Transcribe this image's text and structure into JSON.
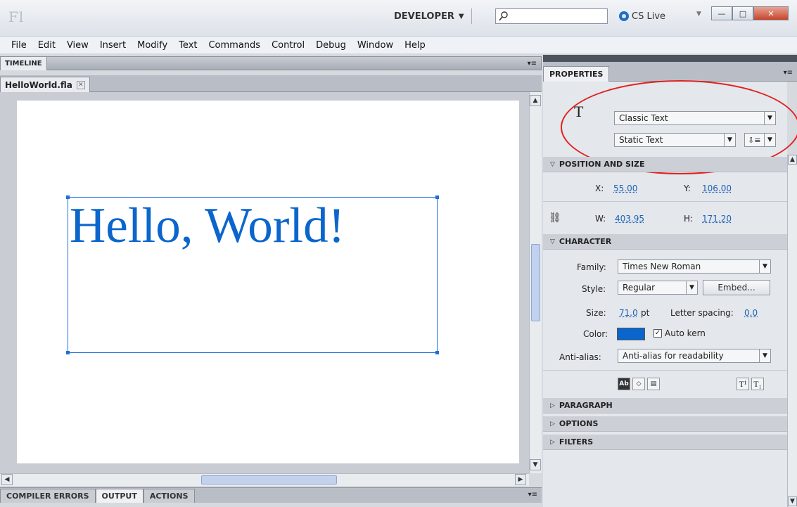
{
  "titlebar": {
    "logo": "Fl",
    "workspace": "DEVELOPER",
    "search_placeholder": "",
    "cslive": "CS Live",
    "minimize": "—",
    "maximize": "□",
    "close": "✕"
  },
  "menu": [
    "File",
    "Edit",
    "View",
    "Insert",
    "Modify",
    "Text",
    "Commands",
    "Control",
    "Debug",
    "Window",
    "Help"
  ],
  "timeline": {
    "tab": "TIMELINE"
  },
  "document": {
    "tab": "HelloWorld.fla",
    "close": "✕"
  },
  "stage": {
    "text": "Hello, World!"
  },
  "bottom_tabs": [
    "COMPILER ERRORS",
    "OUTPUT",
    "ACTIONS"
  ],
  "properties": {
    "tab": "PROPERTIES",
    "tool_icon": "T",
    "text_engine": "Classic Text",
    "text_type": "Static Text",
    "position_and_size": {
      "header": "POSITION AND SIZE",
      "x_label": "X:",
      "x": "55.00",
      "y_label": "Y:",
      "y": "106.00",
      "w_label": "W:",
      "w": "403.95",
      "h_label": "H:",
      "h": "171.20"
    },
    "character": {
      "header": "CHARACTER",
      "family_label": "Family:",
      "family": "Times New Roman",
      "style_label": "Style:",
      "style": "Regular",
      "embed": "Embed...",
      "size_label": "Size:",
      "size": "71.0",
      "size_unit": "pt",
      "letter_spacing_label": "Letter spacing:",
      "letter_spacing": "0.0",
      "color_label": "Color:",
      "color": "#0a66cc",
      "auto_kern": "Auto kern",
      "antialias_label": "Anti-alias:",
      "antialias": "Anti-alias for readability"
    },
    "sections": [
      "PARAGRAPH",
      "OPTIONS",
      "FILTERS"
    ]
  },
  "colors": {
    "accent": "#1e6fd9",
    "annotation": "#e02020"
  }
}
